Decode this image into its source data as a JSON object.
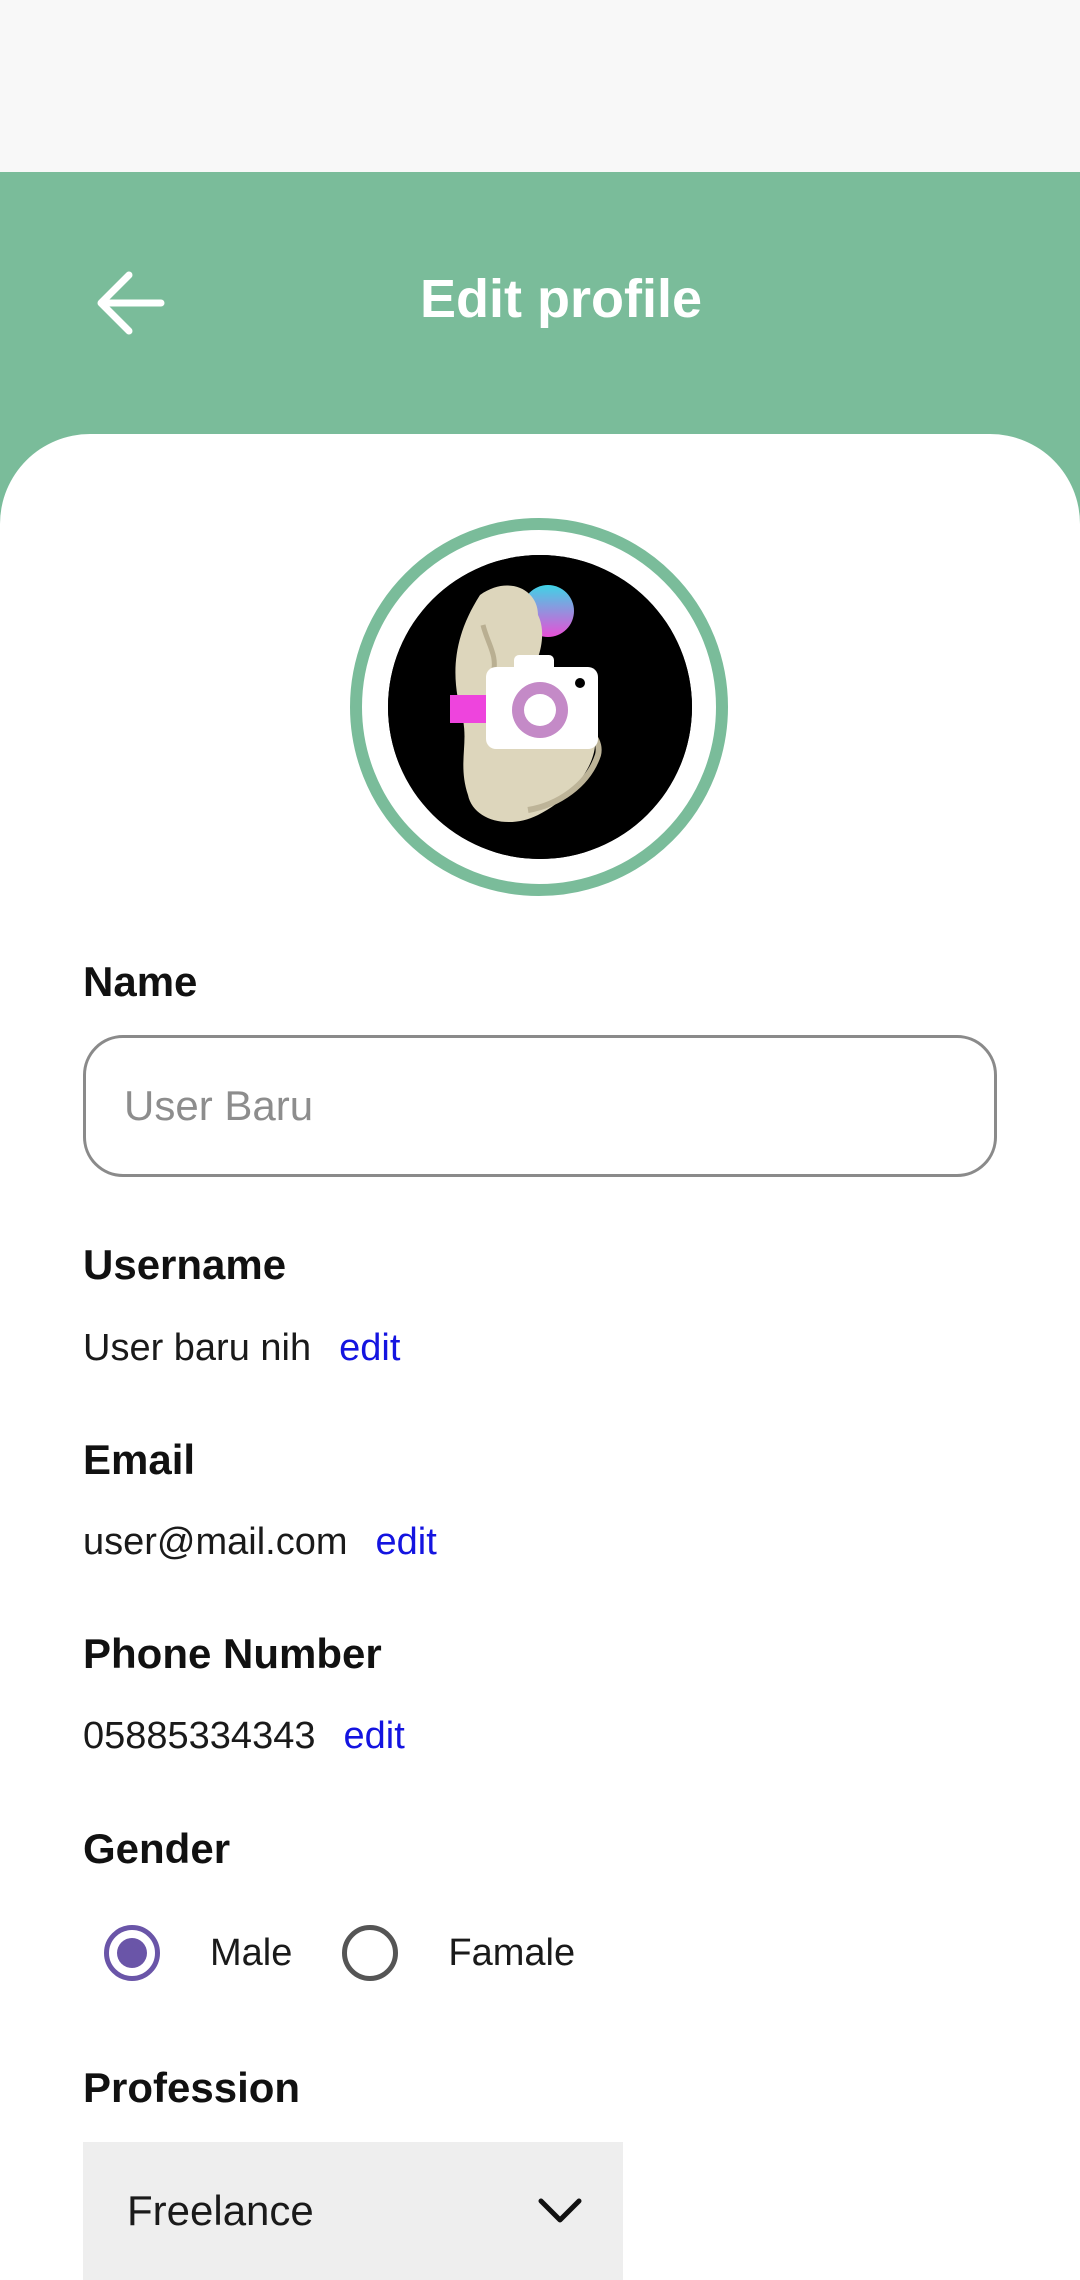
{
  "header": {
    "title": "Edit profile",
    "back_icon": "arrow-left-icon",
    "background_color": "#7abc9a"
  },
  "avatar": {
    "overlay_icon": "camera-icon",
    "ring_color": "#7abc9a"
  },
  "form": {
    "name": {
      "label": "Name",
      "placeholder": "User Baru",
      "value": ""
    },
    "username": {
      "label": "Username",
      "value": "User baru nih",
      "edit_label": "edit"
    },
    "email": {
      "label": "Email",
      "value": "user@mail.com",
      "edit_label": "edit"
    },
    "phone": {
      "label": "Phone Number",
      "value": "05885334343",
      "edit_label": "edit"
    },
    "gender": {
      "label": "Gender",
      "options": [
        "Male",
        "Famale"
      ],
      "selected": "Male"
    },
    "profession": {
      "label": "Profession",
      "selected": "Freelance",
      "dropdown_icon": "chevron-down-icon"
    }
  },
  "colors": {
    "accent": "#7abc9a",
    "link": "#1414e0",
    "radio_selected": "#6a55a8"
  }
}
